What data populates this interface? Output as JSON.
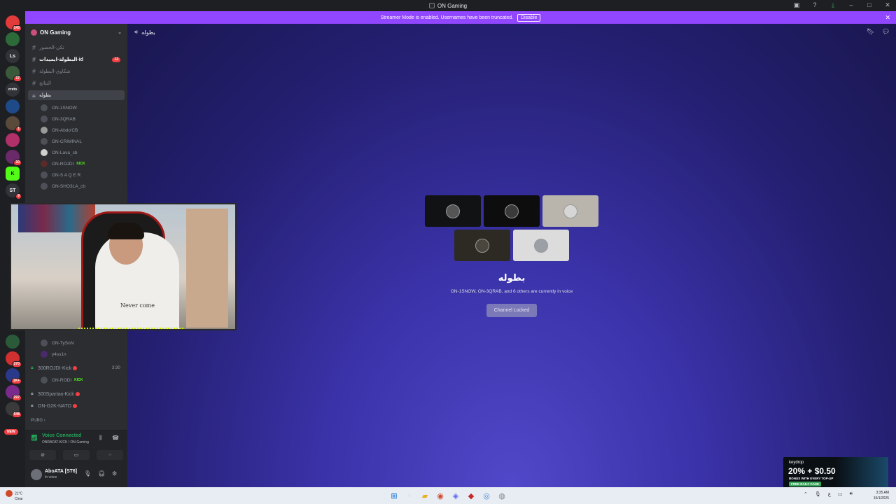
{
  "window": {
    "title": "ON Gaming"
  },
  "banner": {
    "text": "Streamer Mode is enabled. Usernames have been truncated.",
    "button": "Disable"
  },
  "server_rail": {
    "items": [
      {
        "label": "",
        "badge": "143"
      },
      {
        "label": "",
        "badge": ""
      },
      {
        "label": "Ls",
        "badge": ""
      },
      {
        "label": "",
        "badge": "17"
      },
      {
        "label": "creto",
        "badge": ""
      },
      {
        "label": "",
        "badge": ""
      },
      {
        "label": "",
        "badge": "1"
      },
      {
        "label": "",
        "badge": ""
      },
      {
        "label": "",
        "badge": "10"
      },
      {
        "label": "K",
        "badge": ""
      },
      {
        "label": "ST",
        "badge": "9"
      },
      {
        "label": "",
        "badge": ""
      },
      {
        "label": "",
        "badge": "270"
      },
      {
        "label": "",
        "badge": "1K+"
      },
      {
        "label": "",
        "badge": "297"
      },
      {
        "label": "",
        "badge": "548"
      }
    ],
    "new_label": "NEW"
  },
  "sidebar": {
    "guild_name": "ON Gaming",
    "channels": [
      {
        "name": "تكي-الحضور",
        "type": "text"
      },
      {
        "name": "البطولة-ايميدات-id",
        "type": "text",
        "unread": "13"
      },
      {
        "name": "شكاوي-البطولة",
        "type": "text"
      },
      {
        "name": "النتائج",
        "type": "text"
      },
      {
        "name": "بطوله",
        "type": "locked-voice"
      }
    ],
    "voice_users": [
      {
        "name": "ON-1SNOW"
      },
      {
        "name": "ON-3QRAB"
      },
      {
        "name": "ON-Abdo'CB"
      },
      {
        "name": "ON-CRIMINAL"
      },
      {
        "name": "ON-Lava_cb"
      },
      {
        "name": "ON-ROJDI",
        "kick": "KICK"
      },
      {
        "name": "ON-S A Q E R"
      },
      {
        "name": "ON-SHO3LA_cb"
      }
    ],
    "lower_users": [
      {
        "name": "ON-TySoN"
      },
      {
        "name": "y4ss1n"
      }
    ],
    "stream_channels": [
      {
        "name": "300ROJDI-Kick",
        "timer": "3:30"
      },
      {
        "name": "300Spartaa-Kick"
      },
      {
        "name": "ON-G2K-NATO"
      }
    ],
    "rodi_user": {
      "name": "ON-RODI",
      "kick": "KICK"
    },
    "category": "PUBG"
  },
  "voice_panel": {
    "title": "Voice Connected",
    "subtitle": "ONRAFAT-KICK / ON Gaming"
  },
  "user_panel": {
    "name": "AboATA [ST6]",
    "status": "In voice"
  },
  "main": {
    "channel_name": "بطوله",
    "voice_title": "بطوله",
    "voice_sub": "ON-1SNOW, ON-3QRAB, and 6 others are currently in voice",
    "locked_button": "Channel Locked"
  },
  "webcam": {
    "shirt_text": "Never come"
  },
  "ad": {
    "brand": "keydrop",
    "offer": "20% + $0.50",
    "offer_sub": "BONUS WITH EVERY TOP-UP",
    "cta": "FREE DAILY CASE"
  },
  "taskbar": {
    "weather_temp": "21°C",
    "weather_desc": "Clear",
    "time": "3:35 AM",
    "date": "10/1/2025"
  },
  "colors": {
    "accent": "#9146ff",
    "voice_green": "#23a55a",
    "danger": "#f23f43"
  }
}
